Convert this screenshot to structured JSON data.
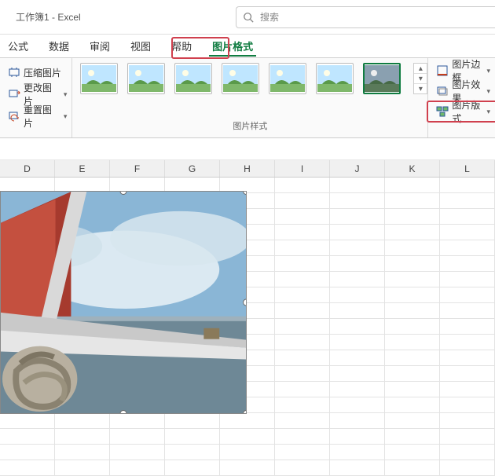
{
  "titlebar": {
    "title": "工作簿1  -  Excel"
  },
  "search": {
    "placeholder": "搜索"
  },
  "tabs": {
    "items": [
      "公式",
      "数据",
      "审阅",
      "视图",
      "帮助",
      "图片格式"
    ],
    "active_index": 5
  },
  "ribbon": {
    "adjust": {
      "compress": "压缩图片",
      "change": "更改图片",
      "reset": "重置图片"
    },
    "styles_group_label": "图片样式",
    "right": {
      "border": "图片边框",
      "effects": "图片效果",
      "layout": "图片版式"
    }
  },
  "grid": {
    "columns": [
      "D",
      "E",
      "F",
      "G",
      "H",
      "I",
      "J",
      "K",
      "L"
    ]
  },
  "icons": {
    "search": "search-icon",
    "compress": "compress-icon",
    "change": "change-picture-icon",
    "reset": "reset-picture-icon",
    "border": "picture-border-icon",
    "effects": "picture-effects-icon",
    "layout": "picture-layout-icon",
    "rotate": "rotate-handle-icon"
  }
}
